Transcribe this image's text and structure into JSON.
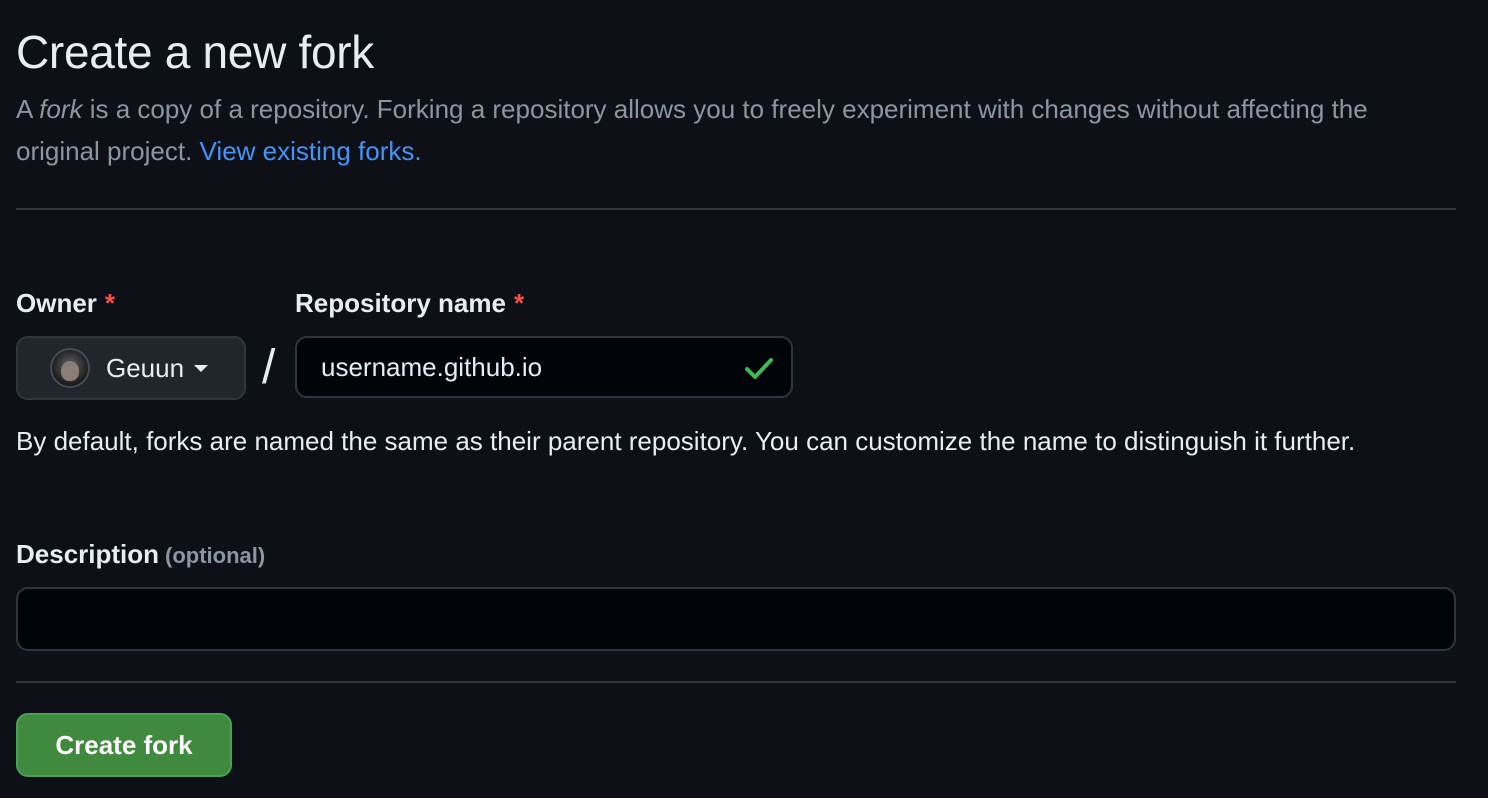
{
  "page": {
    "title": "Create a new fork",
    "subtitle": {
      "prefix": "A ",
      "em": "fork",
      "rest": " is a copy of a repository. Forking a repository allows you to freely experiment with changes without affecting the original project. ",
      "link": "View existing forks."
    }
  },
  "form": {
    "owner": {
      "label": "Owner",
      "required_mark": "*",
      "selected": "Geuun"
    },
    "separator": "/",
    "repository": {
      "label": "Repository name",
      "required_mark": "*",
      "value": "username.github.io"
    },
    "help_text": "By default, forks are named the same as their parent repository. You can customize the name to distinguish it further.",
    "description": {
      "label": "Description",
      "optional": "(optional)",
      "value": ""
    },
    "submit_label": "Create fork"
  },
  "colors": {
    "background": "#0d1117",
    "link": "#4493f8",
    "required": "#f85149",
    "success": "#3fb950",
    "primary_button": "#3f8a3e"
  },
  "icons": {
    "owner_caret": "caret-down-icon",
    "repo_valid": "check-icon"
  }
}
